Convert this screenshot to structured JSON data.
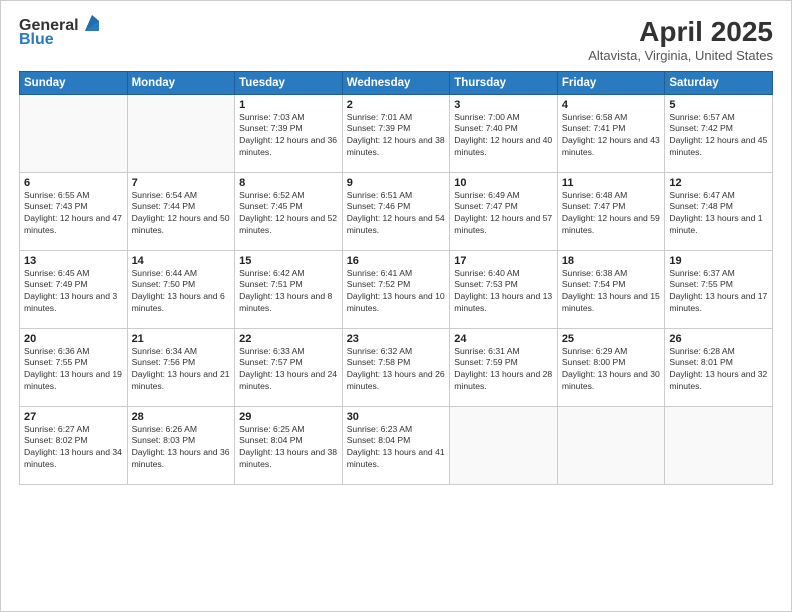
{
  "logo": {
    "general": "General",
    "blue": "Blue"
  },
  "title": "April 2025",
  "subtitle": "Altavista, Virginia, United States",
  "days_of_week": [
    "Sunday",
    "Monday",
    "Tuesday",
    "Wednesday",
    "Thursday",
    "Friday",
    "Saturday"
  ],
  "weeks": [
    [
      {
        "day": "",
        "info": ""
      },
      {
        "day": "",
        "info": ""
      },
      {
        "day": "1",
        "info": "Sunrise: 7:03 AM\nSunset: 7:39 PM\nDaylight: 12 hours and 36 minutes."
      },
      {
        "day": "2",
        "info": "Sunrise: 7:01 AM\nSunset: 7:39 PM\nDaylight: 12 hours and 38 minutes."
      },
      {
        "day": "3",
        "info": "Sunrise: 7:00 AM\nSunset: 7:40 PM\nDaylight: 12 hours and 40 minutes."
      },
      {
        "day": "4",
        "info": "Sunrise: 6:58 AM\nSunset: 7:41 PM\nDaylight: 12 hours and 43 minutes."
      },
      {
        "day": "5",
        "info": "Sunrise: 6:57 AM\nSunset: 7:42 PM\nDaylight: 12 hours and 45 minutes."
      }
    ],
    [
      {
        "day": "6",
        "info": "Sunrise: 6:55 AM\nSunset: 7:43 PM\nDaylight: 12 hours and 47 minutes."
      },
      {
        "day": "7",
        "info": "Sunrise: 6:54 AM\nSunset: 7:44 PM\nDaylight: 12 hours and 50 minutes."
      },
      {
        "day": "8",
        "info": "Sunrise: 6:52 AM\nSunset: 7:45 PM\nDaylight: 12 hours and 52 minutes."
      },
      {
        "day": "9",
        "info": "Sunrise: 6:51 AM\nSunset: 7:46 PM\nDaylight: 12 hours and 54 minutes."
      },
      {
        "day": "10",
        "info": "Sunrise: 6:49 AM\nSunset: 7:47 PM\nDaylight: 12 hours and 57 minutes."
      },
      {
        "day": "11",
        "info": "Sunrise: 6:48 AM\nSunset: 7:47 PM\nDaylight: 12 hours and 59 minutes."
      },
      {
        "day": "12",
        "info": "Sunrise: 6:47 AM\nSunset: 7:48 PM\nDaylight: 13 hours and 1 minute."
      }
    ],
    [
      {
        "day": "13",
        "info": "Sunrise: 6:45 AM\nSunset: 7:49 PM\nDaylight: 13 hours and 3 minutes."
      },
      {
        "day": "14",
        "info": "Sunrise: 6:44 AM\nSunset: 7:50 PM\nDaylight: 13 hours and 6 minutes."
      },
      {
        "day": "15",
        "info": "Sunrise: 6:42 AM\nSunset: 7:51 PM\nDaylight: 13 hours and 8 minutes."
      },
      {
        "day": "16",
        "info": "Sunrise: 6:41 AM\nSunset: 7:52 PM\nDaylight: 13 hours and 10 minutes."
      },
      {
        "day": "17",
        "info": "Sunrise: 6:40 AM\nSunset: 7:53 PM\nDaylight: 13 hours and 13 minutes."
      },
      {
        "day": "18",
        "info": "Sunrise: 6:38 AM\nSunset: 7:54 PM\nDaylight: 13 hours and 15 minutes."
      },
      {
        "day": "19",
        "info": "Sunrise: 6:37 AM\nSunset: 7:55 PM\nDaylight: 13 hours and 17 minutes."
      }
    ],
    [
      {
        "day": "20",
        "info": "Sunrise: 6:36 AM\nSunset: 7:55 PM\nDaylight: 13 hours and 19 minutes."
      },
      {
        "day": "21",
        "info": "Sunrise: 6:34 AM\nSunset: 7:56 PM\nDaylight: 13 hours and 21 minutes."
      },
      {
        "day": "22",
        "info": "Sunrise: 6:33 AM\nSunset: 7:57 PM\nDaylight: 13 hours and 24 minutes."
      },
      {
        "day": "23",
        "info": "Sunrise: 6:32 AM\nSunset: 7:58 PM\nDaylight: 13 hours and 26 minutes."
      },
      {
        "day": "24",
        "info": "Sunrise: 6:31 AM\nSunset: 7:59 PM\nDaylight: 13 hours and 28 minutes."
      },
      {
        "day": "25",
        "info": "Sunrise: 6:29 AM\nSunset: 8:00 PM\nDaylight: 13 hours and 30 minutes."
      },
      {
        "day": "26",
        "info": "Sunrise: 6:28 AM\nSunset: 8:01 PM\nDaylight: 13 hours and 32 minutes."
      }
    ],
    [
      {
        "day": "27",
        "info": "Sunrise: 6:27 AM\nSunset: 8:02 PM\nDaylight: 13 hours and 34 minutes."
      },
      {
        "day": "28",
        "info": "Sunrise: 6:26 AM\nSunset: 8:03 PM\nDaylight: 13 hours and 36 minutes."
      },
      {
        "day": "29",
        "info": "Sunrise: 6:25 AM\nSunset: 8:04 PM\nDaylight: 13 hours and 38 minutes."
      },
      {
        "day": "30",
        "info": "Sunrise: 6:23 AM\nSunset: 8:04 PM\nDaylight: 13 hours and 41 minutes."
      },
      {
        "day": "",
        "info": ""
      },
      {
        "day": "",
        "info": ""
      },
      {
        "day": "",
        "info": ""
      }
    ]
  ]
}
